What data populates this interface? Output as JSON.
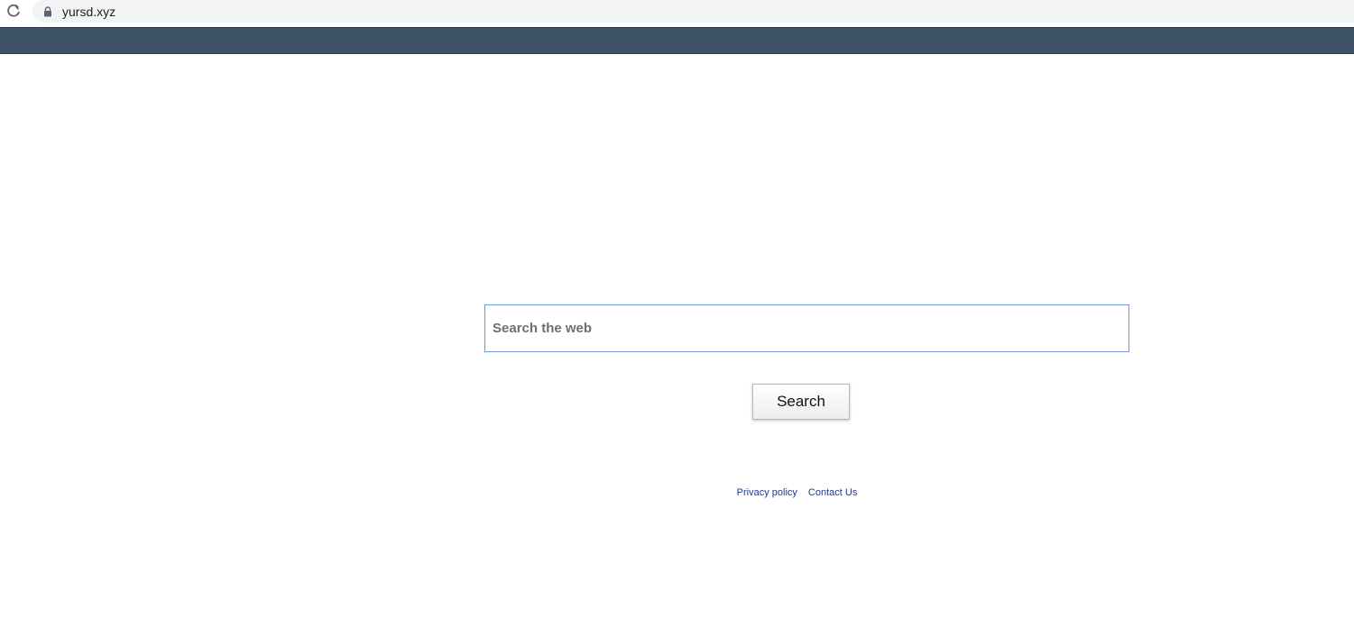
{
  "browser": {
    "url": "yursd.xyz",
    "reload_icon": "reload-icon",
    "lock_icon": "lock-icon"
  },
  "colors": {
    "topbar": "#3e5265",
    "input_border": "#6d9be0",
    "link": "#1a3a8a"
  },
  "search": {
    "placeholder": "Search the web",
    "value": "",
    "button_label": "Search"
  },
  "footer": {
    "links": [
      {
        "label": "Privacy policy"
      },
      {
        "label": "Contact Us"
      }
    ]
  }
}
